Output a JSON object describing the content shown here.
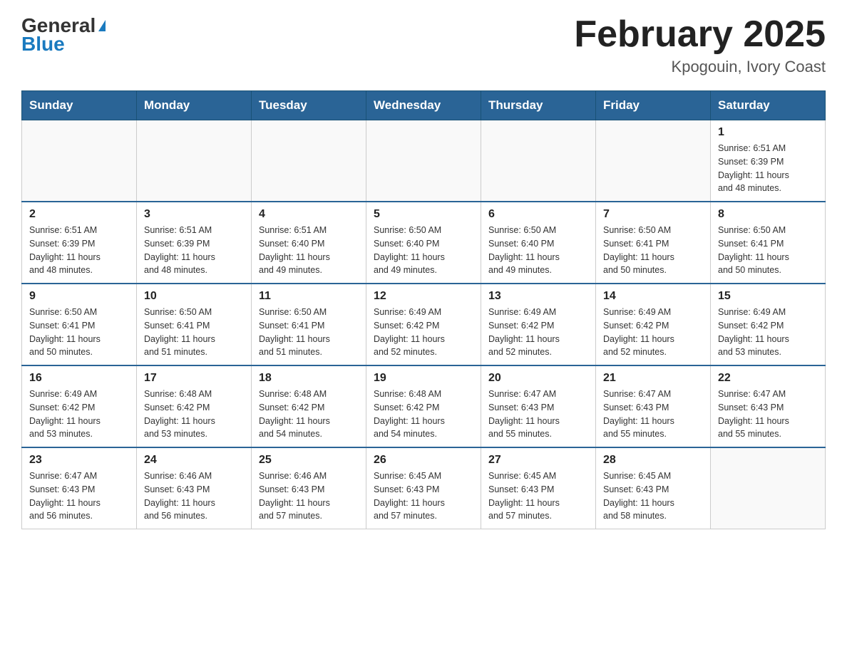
{
  "header": {
    "logo_general": "General",
    "logo_blue": "Blue",
    "month_title": "February 2025",
    "location": "Kpogouin, Ivory Coast"
  },
  "days_of_week": [
    "Sunday",
    "Monday",
    "Tuesday",
    "Wednesday",
    "Thursday",
    "Friday",
    "Saturday"
  ],
  "weeks": [
    {
      "days": [
        {
          "num": "",
          "info": ""
        },
        {
          "num": "",
          "info": ""
        },
        {
          "num": "",
          "info": ""
        },
        {
          "num": "",
          "info": ""
        },
        {
          "num": "",
          "info": ""
        },
        {
          "num": "",
          "info": ""
        },
        {
          "num": "1",
          "info": "Sunrise: 6:51 AM\nSunset: 6:39 PM\nDaylight: 11 hours\nand 48 minutes."
        }
      ]
    },
    {
      "days": [
        {
          "num": "2",
          "info": "Sunrise: 6:51 AM\nSunset: 6:39 PM\nDaylight: 11 hours\nand 48 minutes."
        },
        {
          "num": "3",
          "info": "Sunrise: 6:51 AM\nSunset: 6:39 PM\nDaylight: 11 hours\nand 48 minutes."
        },
        {
          "num": "4",
          "info": "Sunrise: 6:51 AM\nSunset: 6:40 PM\nDaylight: 11 hours\nand 49 minutes."
        },
        {
          "num": "5",
          "info": "Sunrise: 6:50 AM\nSunset: 6:40 PM\nDaylight: 11 hours\nand 49 minutes."
        },
        {
          "num": "6",
          "info": "Sunrise: 6:50 AM\nSunset: 6:40 PM\nDaylight: 11 hours\nand 49 minutes."
        },
        {
          "num": "7",
          "info": "Sunrise: 6:50 AM\nSunset: 6:41 PM\nDaylight: 11 hours\nand 50 minutes."
        },
        {
          "num": "8",
          "info": "Sunrise: 6:50 AM\nSunset: 6:41 PM\nDaylight: 11 hours\nand 50 minutes."
        }
      ]
    },
    {
      "days": [
        {
          "num": "9",
          "info": "Sunrise: 6:50 AM\nSunset: 6:41 PM\nDaylight: 11 hours\nand 50 minutes."
        },
        {
          "num": "10",
          "info": "Sunrise: 6:50 AM\nSunset: 6:41 PM\nDaylight: 11 hours\nand 51 minutes."
        },
        {
          "num": "11",
          "info": "Sunrise: 6:50 AM\nSunset: 6:41 PM\nDaylight: 11 hours\nand 51 minutes."
        },
        {
          "num": "12",
          "info": "Sunrise: 6:49 AM\nSunset: 6:42 PM\nDaylight: 11 hours\nand 52 minutes."
        },
        {
          "num": "13",
          "info": "Sunrise: 6:49 AM\nSunset: 6:42 PM\nDaylight: 11 hours\nand 52 minutes."
        },
        {
          "num": "14",
          "info": "Sunrise: 6:49 AM\nSunset: 6:42 PM\nDaylight: 11 hours\nand 52 minutes."
        },
        {
          "num": "15",
          "info": "Sunrise: 6:49 AM\nSunset: 6:42 PM\nDaylight: 11 hours\nand 53 minutes."
        }
      ]
    },
    {
      "days": [
        {
          "num": "16",
          "info": "Sunrise: 6:49 AM\nSunset: 6:42 PM\nDaylight: 11 hours\nand 53 minutes."
        },
        {
          "num": "17",
          "info": "Sunrise: 6:48 AM\nSunset: 6:42 PM\nDaylight: 11 hours\nand 53 minutes."
        },
        {
          "num": "18",
          "info": "Sunrise: 6:48 AM\nSunset: 6:42 PM\nDaylight: 11 hours\nand 54 minutes."
        },
        {
          "num": "19",
          "info": "Sunrise: 6:48 AM\nSunset: 6:42 PM\nDaylight: 11 hours\nand 54 minutes."
        },
        {
          "num": "20",
          "info": "Sunrise: 6:47 AM\nSunset: 6:43 PM\nDaylight: 11 hours\nand 55 minutes."
        },
        {
          "num": "21",
          "info": "Sunrise: 6:47 AM\nSunset: 6:43 PM\nDaylight: 11 hours\nand 55 minutes."
        },
        {
          "num": "22",
          "info": "Sunrise: 6:47 AM\nSunset: 6:43 PM\nDaylight: 11 hours\nand 55 minutes."
        }
      ]
    },
    {
      "days": [
        {
          "num": "23",
          "info": "Sunrise: 6:47 AM\nSunset: 6:43 PM\nDaylight: 11 hours\nand 56 minutes."
        },
        {
          "num": "24",
          "info": "Sunrise: 6:46 AM\nSunset: 6:43 PM\nDaylight: 11 hours\nand 56 minutes."
        },
        {
          "num": "25",
          "info": "Sunrise: 6:46 AM\nSunset: 6:43 PM\nDaylight: 11 hours\nand 57 minutes."
        },
        {
          "num": "26",
          "info": "Sunrise: 6:45 AM\nSunset: 6:43 PM\nDaylight: 11 hours\nand 57 minutes."
        },
        {
          "num": "27",
          "info": "Sunrise: 6:45 AM\nSunset: 6:43 PM\nDaylight: 11 hours\nand 57 minutes."
        },
        {
          "num": "28",
          "info": "Sunrise: 6:45 AM\nSunset: 6:43 PM\nDaylight: 11 hours\nand 58 minutes."
        },
        {
          "num": "",
          "info": ""
        }
      ]
    }
  ]
}
